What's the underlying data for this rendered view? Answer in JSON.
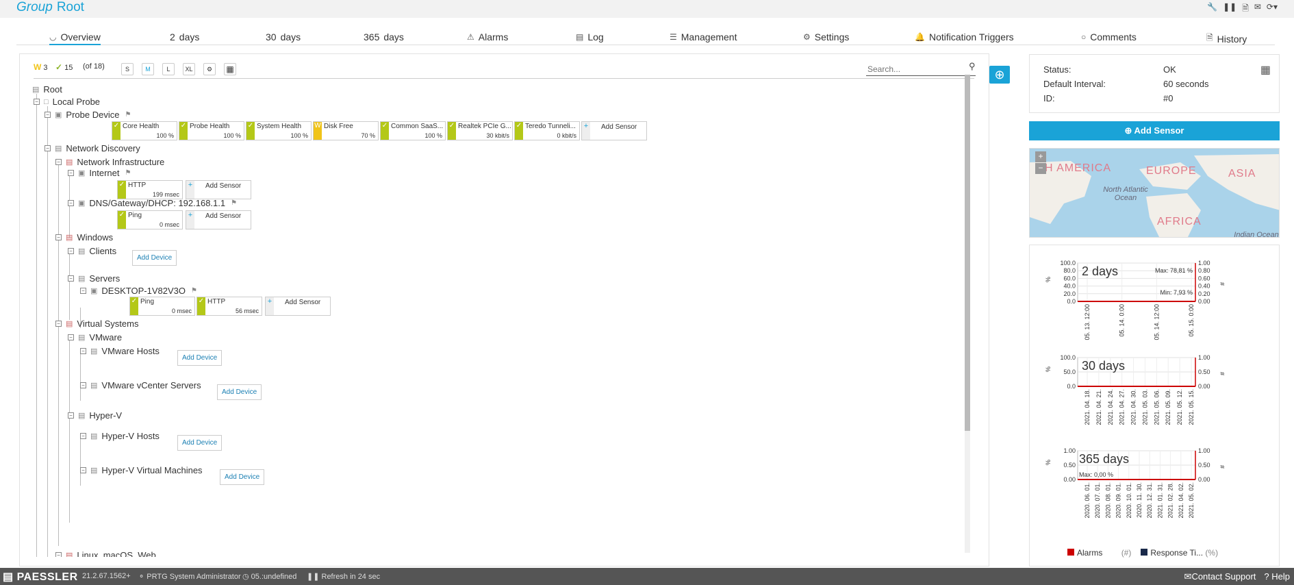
{
  "header": {
    "group_label": "Group",
    "title": "Root"
  },
  "tabs": [
    {
      "label": "Overview",
      "icon": "overview-icon"
    },
    {
      "label": "2",
      "suffix": "days"
    },
    {
      "label": "30",
      "suffix": "days"
    },
    {
      "label": "365",
      "suffix": "days"
    },
    {
      "label": "Alarms",
      "icon": "alarm-icon"
    },
    {
      "label": "Log",
      "icon": "log-icon"
    },
    {
      "label": "Management",
      "icon": "management-icon"
    },
    {
      "label": "Settings",
      "icon": "gear-icon"
    },
    {
      "label": "Notification Triggers",
      "icon": "bell-icon"
    },
    {
      "label": "Comments",
      "icon": "comment-icon"
    },
    {
      "label": "History",
      "icon": "history-icon"
    }
  ],
  "toolbar": {
    "warn_count": "3",
    "ok_count": "15",
    "total": "(of 18)",
    "sizes": [
      "S",
      "M",
      "L",
      "XL"
    ],
    "search_placeholder": "Search..."
  },
  "tree": {
    "root": "Root",
    "local_probe": "Local Probe",
    "probe_device": "Probe Device",
    "network_discovery": "Network Discovery",
    "network_infrastructure": "Network Infrastructure",
    "internet": "Internet",
    "dns": "DNS/Gateway/DHCP: 192.168.1.1",
    "windows": "Windows",
    "clients": "Clients",
    "servers": "Servers",
    "desktop": "DESKTOP-1V82V3O",
    "virtual_systems": "Virtual Systems",
    "vmware": "VMware",
    "vmware_hosts": "VMware Hosts",
    "vcenter": "VMware vCenter Servers",
    "hyperv": "Hyper-V",
    "hyperv_hosts": "Hyper-V Hosts",
    "hyperv_vms": "Hyper-V Virtual Machines",
    "cut_off": "Linux, macOS, Web..."
  },
  "sensors": {
    "probe": [
      {
        "name": "Core Health",
        "value": "100 %",
        "status": "ok"
      },
      {
        "name": "Probe Health",
        "value": "100 %",
        "status": "ok"
      },
      {
        "name": "System Health",
        "value": "100 %",
        "status": "ok"
      },
      {
        "name": "Disk Free",
        "value": "70 %",
        "status": "warning"
      },
      {
        "name": "Common SaaS...",
        "value": "100 %",
        "status": "ok"
      },
      {
        "name": "Realtek PCIe G...",
        "value": "30 kbit/s",
        "status": "ok"
      },
      {
        "name": "Teredo Tunneli...",
        "value": "0 kbit/s",
        "status": "ok"
      }
    ],
    "internet": [
      {
        "name": "HTTP",
        "value": "199 msec",
        "status": "ok"
      }
    ],
    "dns": [
      {
        "name": "Ping",
        "value": "0 msec",
        "status": "ok"
      }
    ],
    "desktop": [
      {
        "name": "Ping",
        "value": "0 msec",
        "status": "ok"
      },
      {
        "name": "HTTP",
        "value": "56 msec",
        "status": "ok"
      }
    ]
  },
  "labels": {
    "add_sensor": "Add Sensor",
    "add_device": "Add Device"
  },
  "info": {
    "status_label": "Status:",
    "status_value": "OK",
    "interval_label": "Default Interval:",
    "interval_value": "60 seconds",
    "id_label": "ID:",
    "id_value": "#0",
    "add_sensor_button": "Add Sensor"
  },
  "map": {
    "labels": [
      "H AMERICA",
      "EUROPE",
      "ASIA",
      "AFRICA"
    ],
    "seas": [
      "North Atlantic Ocean",
      "Indian Ocean"
    ]
  },
  "graphs": [
    {
      "title": "2 days",
      "yleft": [
        "100.0",
        "80.0",
        "60.0",
        "40.0",
        "20.0",
        "0.0"
      ],
      "yright": [
        "1.00",
        "0.80",
        "0.60",
        "0.40",
        "0.20",
        "0.00"
      ],
      "x": [
        "05. 13. 12:00",
        "05. 14. 0:00",
        "05. 14. 12:00",
        "05. 15. 0:00"
      ],
      "max": "Max: 78,81 %",
      "min": "Min: 7,93 %"
    },
    {
      "title": "30 days",
      "yleft": [
        "100.0",
        "50.0",
        "0.0"
      ],
      "yright": [
        "1.00",
        "0.50",
        "0.00"
      ],
      "x": [
        "2021. 04. 18.",
        "2021. 04. 21.",
        "2021. 04. 24.",
        "2021. 04. 27.",
        "2021. 04. 30.",
        "2021. 05. 03.",
        "2021. 05. 06.",
        "2021. 05. 09.",
        "2021. 05. 12.",
        "2021. 05. 15."
      ]
    },
    {
      "title": "365 days",
      "yleft": [
        "1.00",
        "0.50",
        "0.00"
      ],
      "yright": [
        "1.00",
        "0.50",
        "0.00"
      ],
      "x": [
        "2020. 06. 01.",
        "2020. 07. 01.",
        "2020. 08. 01.",
        "2020. 09. 01.",
        "2020. 10. 01.",
        "2020. 11. 30.",
        "2020. 12. 31.",
        "2021. 01. 31.",
        "2021. 02. 28.",
        "2021. 04. 02.",
        "2021. 05. 02."
      ],
      "max": "Max: 0,00 %"
    }
  ],
  "graph_units": {
    "left": "%",
    "right": "#"
  },
  "legend": [
    {
      "label": "Alarms",
      "unit": "(#)",
      "color": "#cc0000"
    },
    {
      "label": "Response Ti...",
      "unit": "(%)",
      "color": "#1a2a4a"
    }
  ],
  "status_bar": {
    "logo": "PAESSLER",
    "version": "21.2.67.1562+",
    "user": "PRTG System Administrator",
    "time": "05.:undefined",
    "refresh": "Refresh in 24 sec",
    "contact": "Contact Support",
    "help": "Help"
  }
}
